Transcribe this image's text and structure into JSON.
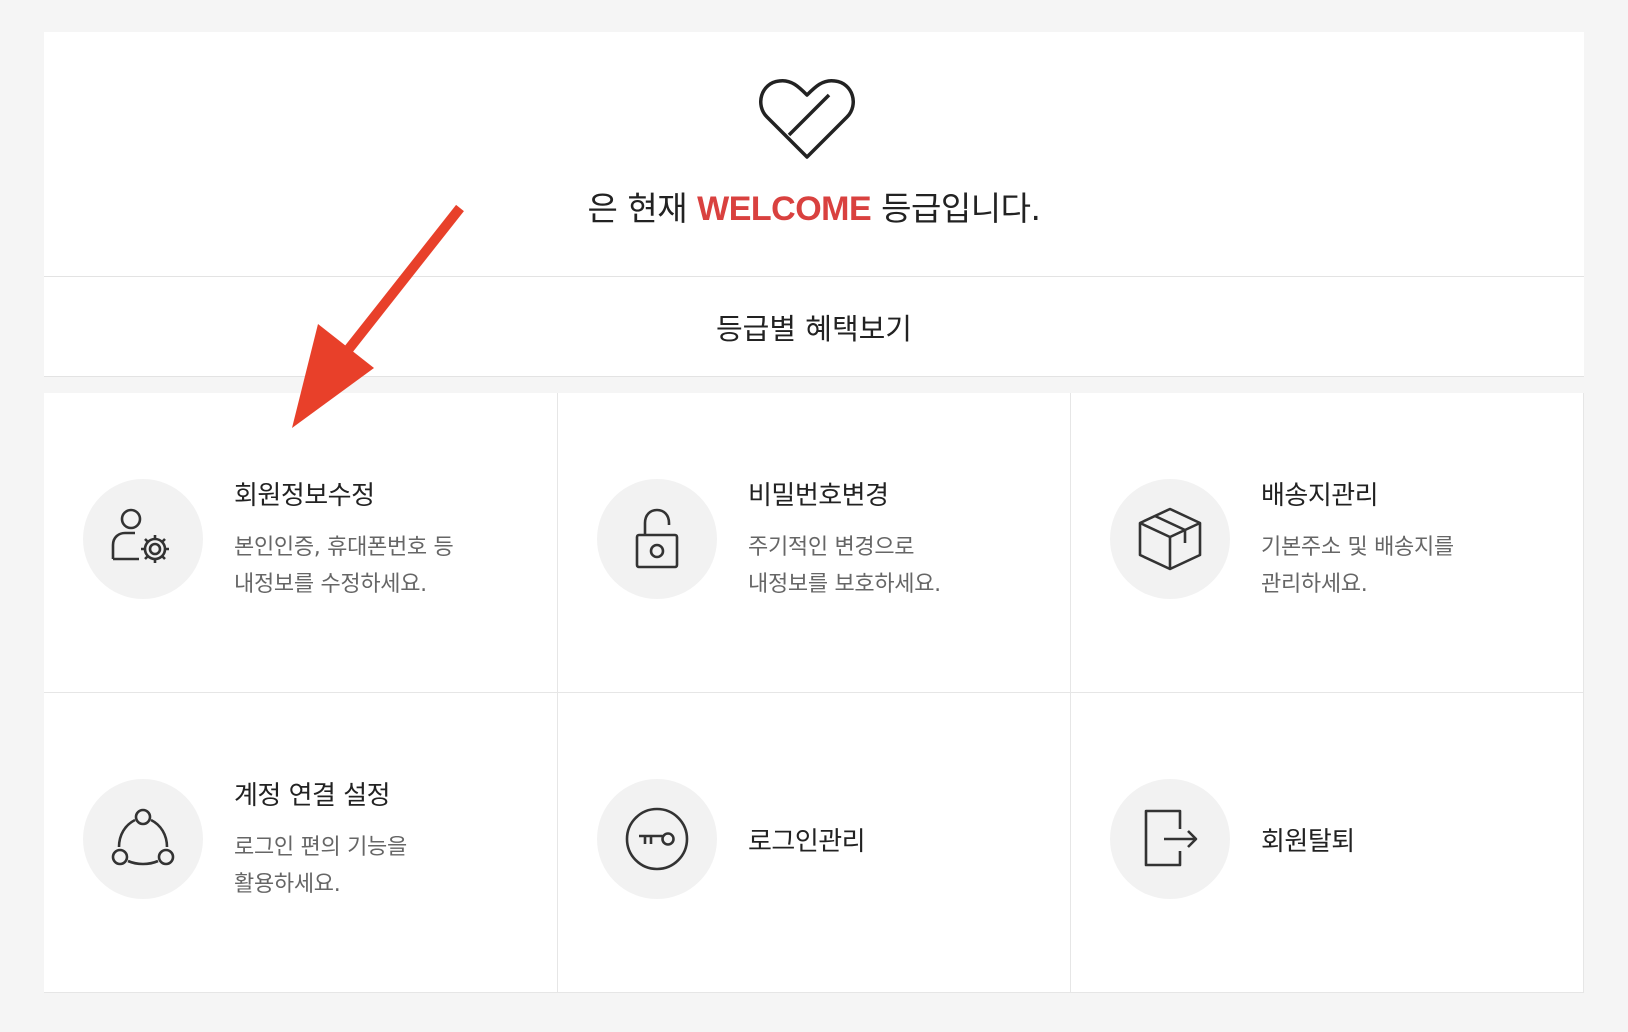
{
  "grade": {
    "prefix": "은 현재",
    "level": "WELCOME",
    "suffix": "등급입니다."
  },
  "benefit_link": "등급별 혜택보기",
  "menu": [
    {
      "title": "회원정보수정",
      "desc1": "본인인증, 휴대폰번호 등",
      "desc2": "내정보를 수정하세요.",
      "icon": "user-settings-icon"
    },
    {
      "title": "비밀번호변경",
      "desc1": "주기적인 변경으로",
      "desc2": "내정보를 보호하세요.",
      "icon": "padlock-icon"
    },
    {
      "title": "배송지관리",
      "desc1": "기본주소 및 배송지를",
      "desc2": "관리하세요.",
      "icon": "package-box-icon"
    },
    {
      "title": "계정 연결 설정",
      "desc1": "로그인 편의 기능을",
      "desc2": "활용하세요.",
      "icon": "account-link-icon"
    },
    {
      "title": "로그인관리",
      "icon": "key-icon"
    },
    {
      "title": "회원탈퇴",
      "icon": "exit-icon"
    }
  ],
  "colors": {
    "accent": "#d9413f",
    "arrow": "#e8402a"
  }
}
